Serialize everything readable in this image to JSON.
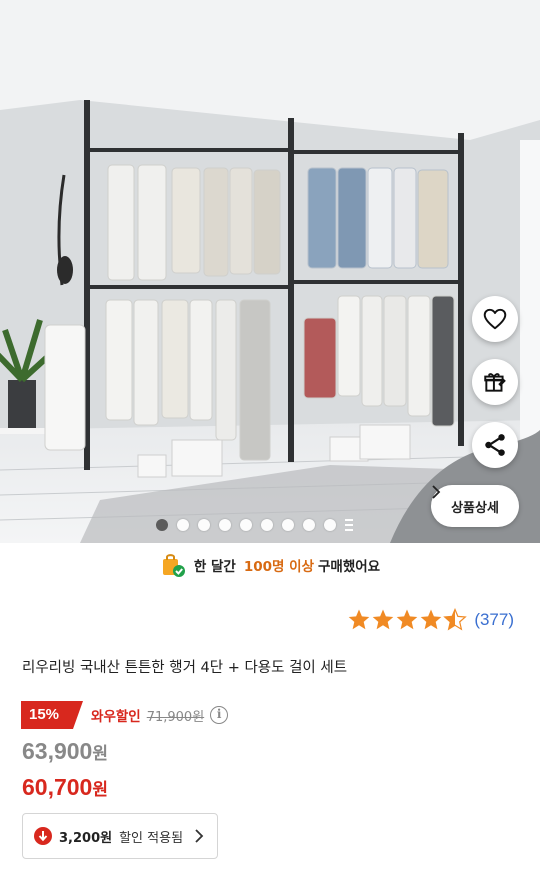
{
  "hero": {
    "image": "garment-rack-photo",
    "carousel_total": 10,
    "carousel_active": 0,
    "detail_button": "상품상세",
    "actions": [
      "heart-icon",
      "gift-icon",
      "share-icon"
    ]
  },
  "purchase_banner": {
    "prefix": "한 달간",
    "count": "100명 이상",
    "suffix": "구매했어요"
  },
  "rating": {
    "stars": 4.5,
    "count": "(377)"
  },
  "product": {
    "title": "리우리빙 국내산 튼튼한 행거 4단 + 다용도 걸이 세트"
  },
  "price": {
    "discount_rate": "15%",
    "wow_label": "와우할인",
    "original": "71,900원",
    "sale": "63,900",
    "wow_price": "60,700",
    "currency": "원"
  },
  "coupon": {
    "amount": "3,200원",
    "label": "할인 적용됨"
  },
  "colors": {
    "accent_red": "#d8281e",
    "accent_orange": "#d86a12",
    "rating_blue": "#3a6fd0",
    "star": "#f08a24"
  }
}
